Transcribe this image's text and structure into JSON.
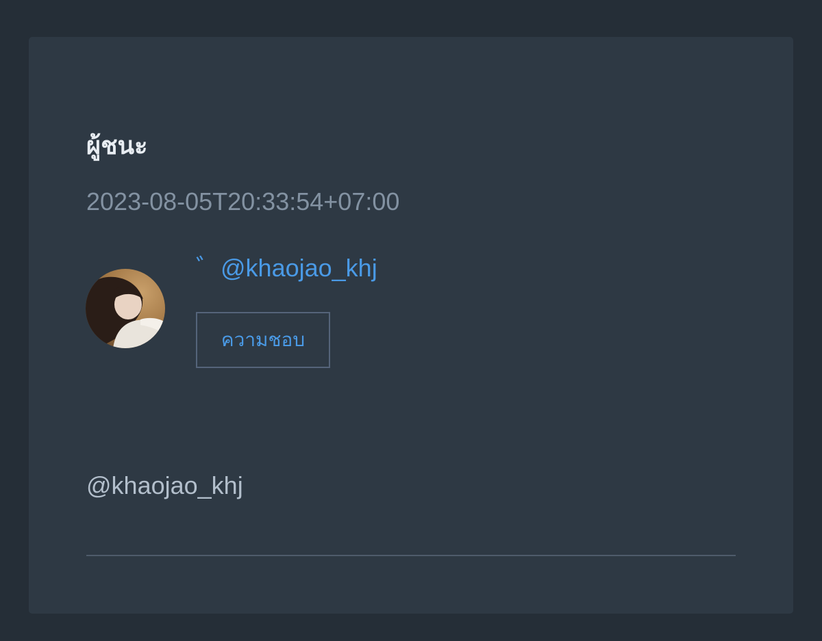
{
  "card": {
    "title": "ผู้ชนะ",
    "timestamp": "2023-08-05T20:33:54+07:00",
    "winner": {
      "handle_link": "゛@khaojao_khj",
      "follow_label": "ความชอบ",
      "avatar_icon": "user-photo-avatar"
    },
    "handle_text": "@khaojao_khj"
  },
  "colors": {
    "page_bg": "#252e37",
    "card_bg": "#2e3944",
    "accent": "#4a9ae6",
    "muted": "#8392a2"
  }
}
